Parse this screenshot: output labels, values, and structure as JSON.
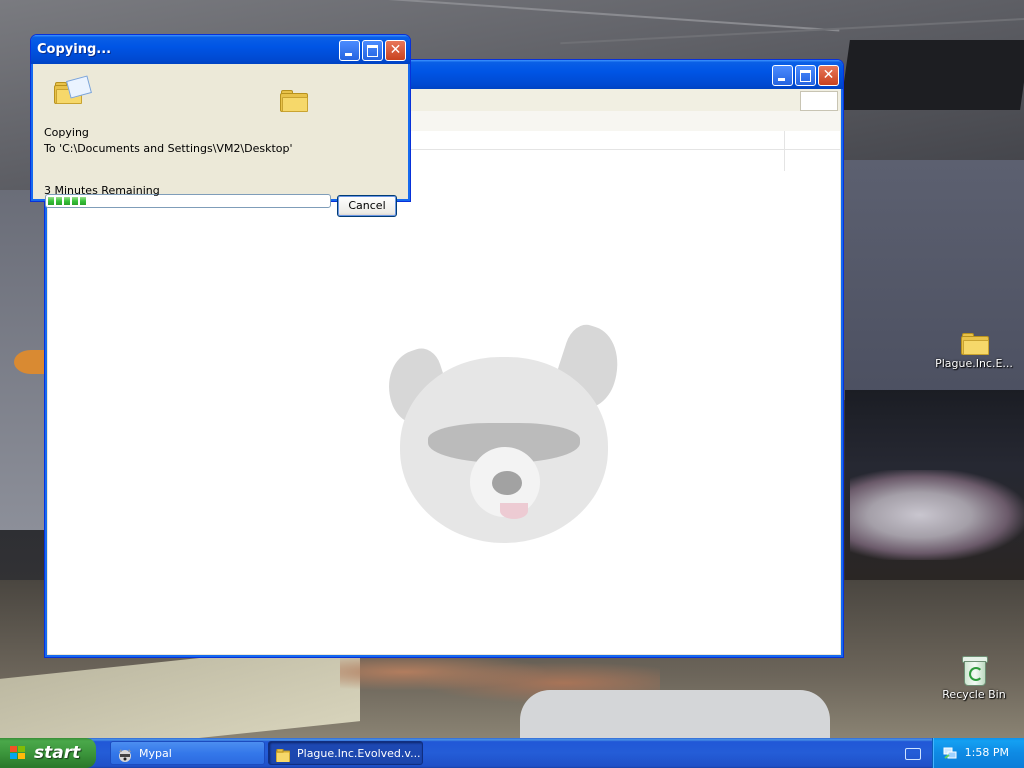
{
  "copy_dialog": {
    "title": "Copying...",
    "status_label": "Copying",
    "destination": "To 'C:\\Documents and Settings\\VM2\\Desktop'",
    "progress_fraction": 0.14,
    "progress_blocks": 5,
    "time_remaining": "3 Minutes Remaining",
    "cancel_label": "Cancel"
  },
  "desktop": {
    "icons": [
      {
        "label": "Plague.Inc.E...",
        "icon": "folder-icon"
      },
      {
        "label": "Recycle Bin",
        "icon": "recycle-bin-icon"
      }
    ]
  },
  "taskbar": {
    "start_label": "start",
    "tasks": [
      {
        "label": "Mypal",
        "icon": "raccoon-icon",
        "active": false
      },
      {
        "label": "Plague.Inc.Evolved.v...",
        "icon": "folder-icon",
        "active": true
      }
    ],
    "clock": "1:58 PM"
  },
  "colors": {
    "titlebar_blue": "#0055e5",
    "start_green": "#3c963c",
    "progress_green": "#37c23a",
    "tray_blue": "#0e8ae4"
  }
}
